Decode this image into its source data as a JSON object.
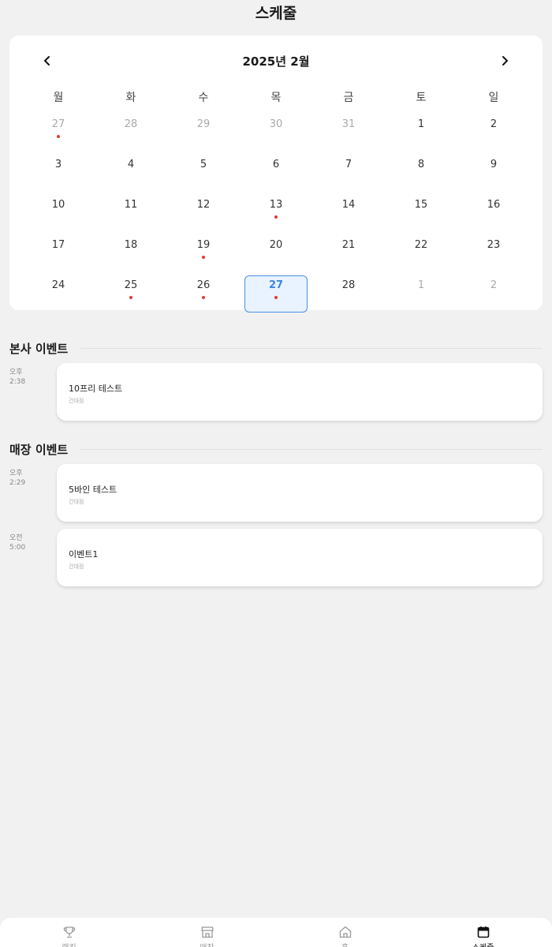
{
  "header": {
    "title": "스케줄"
  },
  "calendar": {
    "month_label": "2025년 2월",
    "weekdays": [
      "월",
      "화",
      "수",
      "목",
      "금",
      "토",
      "일"
    ],
    "weeks": [
      [
        {
          "day": "27",
          "muted": true,
          "dot": true
        },
        {
          "day": "28",
          "muted": true,
          "dot": false
        },
        {
          "day": "29",
          "muted": true,
          "dot": false
        },
        {
          "day": "30",
          "muted": true,
          "dot": false
        },
        {
          "day": "31",
          "muted": true,
          "dot": false
        },
        {
          "day": "1",
          "muted": false,
          "dot": false
        },
        {
          "day": "2",
          "muted": false,
          "dot": false
        }
      ],
      [
        {
          "day": "3",
          "muted": false,
          "dot": false
        },
        {
          "day": "4",
          "muted": false,
          "dot": false
        },
        {
          "day": "5",
          "muted": false,
          "dot": false
        },
        {
          "day": "6",
          "muted": false,
          "dot": false
        },
        {
          "day": "7",
          "muted": false,
          "dot": false
        },
        {
          "day": "8",
          "muted": false,
          "dot": false
        },
        {
          "day": "9",
          "muted": false,
          "dot": false
        }
      ],
      [
        {
          "day": "10",
          "muted": false,
          "dot": false
        },
        {
          "day": "11",
          "muted": false,
          "dot": false
        },
        {
          "day": "12",
          "muted": false,
          "dot": false
        },
        {
          "day": "13",
          "muted": false,
          "dot": true
        },
        {
          "day": "14",
          "muted": false,
          "dot": false
        },
        {
          "day": "15",
          "muted": false,
          "dot": false
        },
        {
          "day": "16",
          "muted": false,
          "dot": false
        }
      ],
      [
        {
          "day": "17",
          "muted": false,
          "dot": false
        },
        {
          "day": "18",
          "muted": false,
          "dot": false
        },
        {
          "day": "19",
          "muted": false,
          "dot": true
        },
        {
          "day": "20",
          "muted": false,
          "dot": false
        },
        {
          "day": "21",
          "muted": false,
          "dot": false
        },
        {
          "day": "22",
          "muted": false,
          "dot": false
        },
        {
          "day": "23",
          "muted": false,
          "dot": false
        }
      ],
      [
        {
          "day": "24",
          "muted": false,
          "dot": false
        },
        {
          "day": "25",
          "muted": false,
          "dot": true
        },
        {
          "day": "26",
          "muted": false,
          "dot": true
        },
        {
          "day": "27",
          "muted": false,
          "dot": true,
          "selected": true
        },
        {
          "day": "28",
          "muted": false,
          "dot": false
        },
        {
          "day": "1",
          "muted": true,
          "dot": false
        },
        {
          "day": "2",
          "muted": true,
          "dot": false
        }
      ]
    ]
  },
  "sections": {
    "hq": {
      "title": "본사 이벤트",
      "events": [
        {
          "period": "오후",
          "time": "2:38",
          "title": "10프리 테스트",
          "subtitle": "건대점"
        }
      ]
    },
    "store": {
      "title": "매장 이벤트",
      "events": [
        {
          "period": "오후",
          "time": "2:29",
          "title": "5바인 테스트",
          "subtitle": "건대점"
        },
        {
          "period": "오전",
          "time": "5:00",
          "title": "이벤트1",
          "subtitle": "건대점"
        }
      ]
    }
  },
  "colors": {
    "accent": "#3b86e0",
    "selected_bg": "#e9f2ff",
    "event_dot": "#e53935",
    "background": "#f1f1f1"
  },
  "bottom_nav": {
    "items": [
      {
        "icon": "trophy-icon",
        "label": "랭킹",
        "active": false
      },
      {
        "icon": "store-icon",
        "label": "매장",
        "active": false
      },
      {
        "icon": "home-icon",
        "label": "홈",
        "active": false
      },
      {
        "icon": "calendar-icon",
        "label": "스케줄",
        "active": true
      }
    ]
  }
}
